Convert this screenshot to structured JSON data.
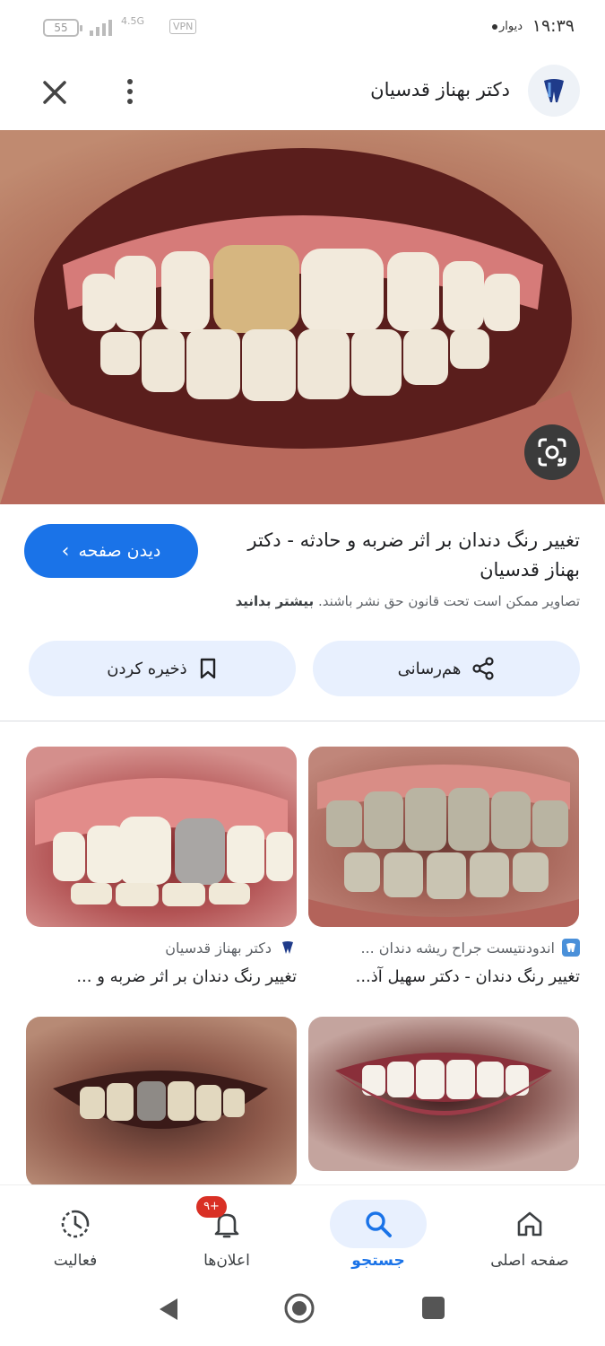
{
  "status_bar": {
    "time": "۱۹:۳۹",
    "carrier": "دیوار",
    "battery": "55",
    "network": "4.5G",
    "vpn": "VPN"
  },
  "top_bar": {
    "site_name": "دکتر بهناز قدسیان",
    "logo_icon": "tooth-logo-icon",
    "more_icon": "more-vert-icon",
    "close_icon": "close-icon"
  },
  "result": {
    "title": "تغییر رنگ دندان بر اثر ضربه و حادثه - دکتر بهناز قدسیان",
    "visit_label": "دیدن صفحه",
    "copyright_text": "تصاویر ممکن است تحت قانون حق نشر باشند.",
    "learn_more": "بیشتر بدانید"
  },
  "actions": {
    "share_label": "هم‌رسانی",
    "save_label": "ذخیره کردن"
  },
  "related": [
    {
      "source": "اندودنتیست جراح ریشه دندان ...",
      "title": "تغییر رنگ دندان - دکتر سهیل آذ..."
    },
    {
      "source": "دکتر بهناز قدسیان",
      "title": "تغییر رنگ دندان بر اثر ضربه و ..."
    }
  ],
  "bottom_nav": {
    "home": "صفحه اصلی",
    "search": "جستجو",
    "notifications": "اعلان‌ها",
    "notifications_badge": "۹+",
    "activity": "فعالیت"
  },
  "colors": {
    "accent": "#1a73e8",
    "chip_bg": "#e8f0fe",
    "badge": "#d93025"
  }
}
